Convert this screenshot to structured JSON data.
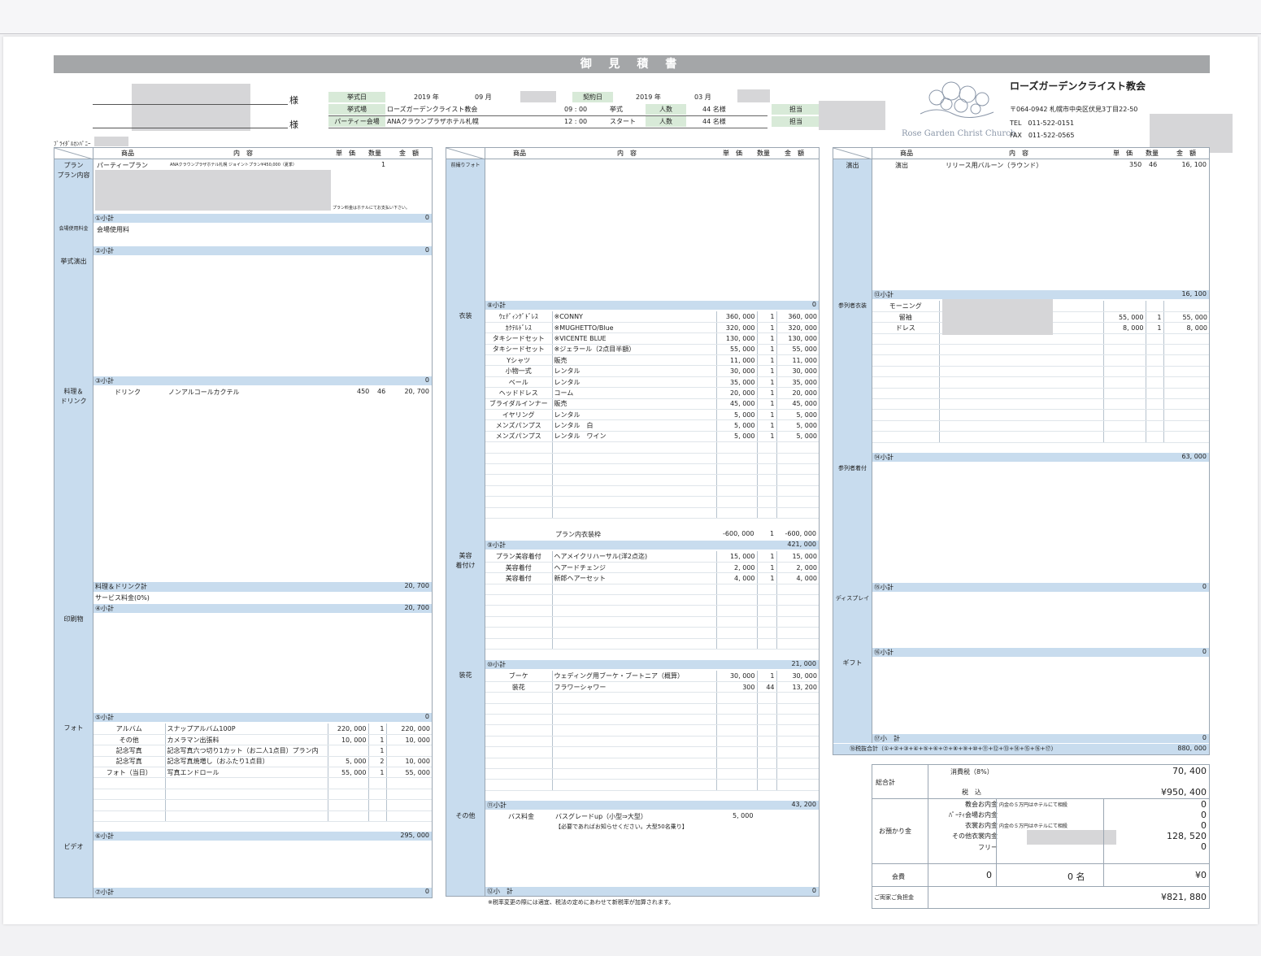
{
  "header": {
    "title": "御 見 積 書",
    "sama1": "様",
    "sama2": "様",
    "groom_bride_label": "ﾌﾞﾗｲﾀﾞﾙｶﾝﾊﾟﾆｰ",
    "kyoshiki_label": "挙式日",
    "kyoshiki_year": "2019 年",
    "kyoshiki_month": "09 月",
    "contract_label": "契約日",
    "contract_year": "2019 年",
    "contract_month": "03 月",
    "venue_label": "挙式場",
    "venue_value": "ローズガーデンクライスト教会",
    "venue_time": "09 : 00",
    "venue_kind": "挙式",
    "venue_people_label": "人数",
    "venue_people": "44 名様",
    "party_label": "パーティー会場",
    "party_value": "ANAクラウンプラザホテル札幌",
    "party_time": "12 : 00",
    "party_kind": "スタート",
    "party_people_label": "人数",
    "party_people": "44 名様",
    "tanto1": "担当",
    "tanto2": "担当"
  },
  "company": {
    "name": "ローズガーデンクライスト教会",
    "logo_text": "Rose Garden Christ Church",
    "address": "〒064-0942 札幌市中央区伏見3丁目22-50",
    "tel": "TEL　011-522-0151",
    "fax": "FAX　011-522-0565"
  },
  "columns": {
    "item": "商品",
    "content": "内　容",
    "price": "単　価",
    "qty": "数量",
    "amount": "金　額"
  },
  "col1": {
    "plan_label": "プラン\nプラン内容",
    "plan_item": "パーティープラン",
    "plan_content": "ANAクラウンプラザホテル札幌 ジョイントプラン¥450,000（夏季）",
    "plan_qty": "1",
    "plan_note": "プラン料金はホテルにてお支払い下さい。",
    "sub1": "①小計",
    "sub1_val": "0",
    "venue_fee_label": "会場使用料金",
    "venue_fee_item": "会場使用料",
    "sub2": "②小計",
    "sub2_val": "0",
    "ceremony_label": "挙式演出",
    "sub3": "③小計",
    "sub3_val": "0",
    "food_label": "料理＆\nドリンク",
    "drink_item": "ドリンク",
    "drink_content": "ノンアルコールカクテル",
    "drink_price": "450",
    "drink_qty": "46",
    "drink_amount": "20, 700",
    "food_total": "料理＆ドリンク計",
    "food_total_val": "20, 700",
    "service": "サービス料金(0%)",
    "sub4": "④小計",
    "sub4_val": "20, 700",
    "print_label": "印刷物",
    "sub5": "⑤小計",
    "sub5_val": "0",
    "photo_label": "フォト",
    "photos": [
      {
        "item": "アルバム",
        "content": "スナップアルバム100P",
        "price": "220, 000",
        "qty": "1",
        "amount": "220, 000"
      },
      {
        "item": "その他",
        "content": "カメラマン出張料",
        "price": "10, 000",
        "qty": "1",
        "amount": "10, 000"
      },
      {
        "item": "記念写真",
        "content": "記念写真六つ切り1カット（お二人1点目）プラン内",
        "price": "",
        "qty": "1",
        "amount": ""
      },
      {
        "item": "記念写真",
        "content": "記念写真焼増し（おふたり1点目）",
        "price": "5, 000",
        "qty": "2",
        "amount": "10, 000"
      },
      {
        "item": "フォト（当日）",
        "content": "写真エンドロール",
        "price": "55, 000",
        "qty": "1",
        "amount": "55, 000"
      }
    ],
    "sub6": "⑥小計",
    "sub6_val": "295, 000",
    "video_label": "ビデオ",
    "sub7": "⑦小計",
    "sub7_val": "0"
  },
  "col2": {
    "prephoto_label": "前撮りフォト",
    "sub8": "⑧小計",
    "sub8_val": "0",
    "costume_label": "衣装",
    "costumes": [
      {
        "item": "ｳｪﾃﾞｨﾝｸﾞﾄﾞﾚｽ",
        "content": "※CONNY",
        "price": "360, 000",
        "qty": "1",
        "amount": "360, 000"
      },
      {
        "item": "ｶｸﾃﾙﾄﾞﾚｽ",
        "content": "※MUGHETTO/Blue",
        "price": "320, 000",
        "qty": "1",
        "amount": "320, 000"
      },
      {
        "item": "タキシードセット",
        "content": "※VICENTE BLUE",
        "price": "130, 000",
        "qty": "1",
        "amount": "130, 000"
      },
      {
        "item": "タキシードセット",
        "content": "※ジェラール（2点目半額）",
        "price": "55, 000",
        "qty": "1",
        "amount": "55, 000"
      },
      {
        "item": "Yシャツ",
        "content": "販売",
        "price": "11, 000",
        "qty": "1",
        "amount": "11, 000"
      },
      {
        "item": "小物一式",
        "content": "レンタル",
        "price": "30, 000",
        "qty": "1",
        "amount": "30, 000"
      },
      {
        "item": "ベール",
        "content": "レンタル",
        "price": "35, 000",
        "qty": "1",
        "amount": "35, 000"
      },
      {
        "item": "ヘッドドレス",
        "content": "コーム",
        "price": "20, 000",
        "qty": "1",
        "amount": "20, 000"
      },
      {
        "item": "ブライダルインナー",
        "content": "販売",
        "price": "45, 000",
        "qty": "1",
        "amount": "45, 000"
      },
      {
        "item": "イヤリング",
        "content": "レンタル",
        "price": "5, 000",
        "qty": "1",
        "amount": "5, 000"
      },
      {
        "item": "メンズパンプス",
        "content": "レンタル　白",
        "price": "5, 000",
        "qty": "1",
        "amount": "5, 000"
      },
      {
        "item": "メンズパンプス",
        "content": "レンタル　ワイン",
        "price": "5, 000",
        "qty": "1",
        "amount": "5, 000"
      }
    ],
    "plan_costume": "プラン内衣装枠",
    "plan_costume_price": "-600, 000",
    "plan_costume_qty": "1",
    "plan_costume_amount": "-600, 000",
    "sub9": "⑨小計",
    "sub9_val": "421, 000",
    "beauty_label": "美容\n着付け",
    "beauty": [
      {
        "item": "プラン美容着付",
        "content": "ヘアメイクリハーサル(洋2点迄)",
        "price": "15, 000",
        "qty": "1",
        "amount": "15, 000"
      },
      {
        "item": "美容着付",
        "content": "ヘアードチェンジ",
        "price": "2, 000",
        "qty": "1",
        "amount": "2, 000"
      },
      {
        "item": "美容着付",
        "content": "新郎ヘアーセット",
        "price": "4, 000",
        "qty": "1",
        "amount": "4, 000"
      }
    ],
    "sub10": "⑩小計",
    "sub10_val": "21, 000",
    "flower_label": "装花",
    "flowers": [
      {
        "item": "ブーケ",
        "content": "ウェディング用ブーケ・ブートニア（概算）",
        "price": "30, 000",
        "qty": "1",
        "amount": "30, 000"
      },
      {
        "item": "装花",
        "content": "フラワーシャワー",
        "price": "300",
        "qty": "44",
        "amount": "13, 200"
      }
    ],
    "sub11": "⑪小計",
    "sub11_val": "43, 200",
    "other_label": "その他",
    "other_item": "バス料金",
    "other_content": "バスグレードup（小型⇒大型）",
    "other_price": "5, 000",
    "other_note": "【必要であればお知らせください。大型50名乗り】",
    "sub12": "⑫小　計",
    "sub12_val": "0",
    "footnote": "※税率変更の際には適宜、税法の定めにあわせて新税率が加算されます。"
  },
  "col3": {
    "produce_label": "演出",
    "produce_item": "演出",
    "produce_content": "リリース用バルーン（ラウンド）",
    "produce_price": "350",
    "produce_qty": "46",
    "produce_amount": "16, 100",
    "sub13": "⑬小計",
    "sub13_val": "16, 100",
    "guest_costume_label": "参列者衣装",
    "guest_costumes": [
      {
        "item": "モーニング",
        "price": "",
        "qty": "",
        "amount": ""
      },
      {
        "item": "留袖",
        "price": "55, 000",
        "qty": "1",
        "amount": "55, 000"
      },
      {
        "item": "ドレス",
        "price": "8, 000",
        "qty": "1",
        "amount": "8, 000"
      }
    ],
    "sub14": "⑭小計",
    "sub14_val": "63, 000",
    "guest_dress_label": "参列者着付",
    "sub15": "⑮小計",
    "sub15_val": "0",
    "display_label": "ディスプレイ",
    "sub16": "⑯小計",
    "sub16_val": "0",
    "gift_label": "ギフト",
    "sub17": "⑰小　計",
    "sub17_val": "0",
    "pretax_label": "⑱税抜合計（①+②+③+④+⑤+⑥+⑦+⑧+⑨+⑩+⑪+⑫+⑬+⑭+⑮+⑯+⑰）",
    "pretax_val": "880, 000"
  },
  "summary": {
    "total_label": "総合計",
    "tax_label": "消費税（8%）",
    "tax_val": "70, 400",
    "incl_label": "税　込",
    "incl_val": "¥950, 400",
    "deposit_label": "お預かり金",
    "church_label": "教会お内金",
    "church_note": "内金の５万円はホテルにて相殺",
    "church_val": "0",
    "party_label": "ﾊﾟｰﾃｨ会場お内金",
    "party_val": "0",
    "costume_label": "衣裳お内金",
    "costume_note": "内金の５万円はホテルにて相殺",
    "costume_val": "0",
    "other_costume_label": "その他衣裳内金",
    "other_costume_val": "128, 520",
    "free_label": "フリー",
    "free_val": "0",
    "kaihi_label": "会費",
    "kaihi_a": "0",
    "kaihi_b": "0 名",
    "kaihi_c": "¥0",
    "burden_label": "ご両家ご負担金",
    "burden_val": "¥821, 880"
  }
}
